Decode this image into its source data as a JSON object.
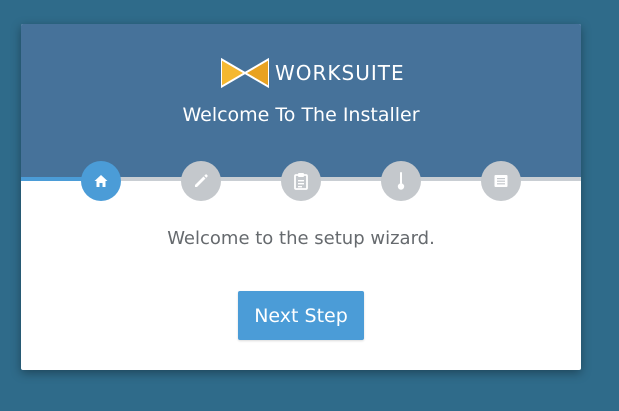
{
  "brand": {
    "name": "WORKSUITE",
    "icon": "bowtie-logo-icon",
    "colors": {
      "left": "#f5b830",
      "right": "#e8a221"
    }
  },
  "header": {
    "title": "Welcome To The Installer",
    "background": "#46729a"
  },
  "steps": [
    {
      "icon": "home-icon",
      "active": true
    },
    {
      "icon": "pencil-icon",
      "active": false
    },
    {
      "icon": "clipboard-icon",
      "active": false
    },
    {
      "icon": "thermometer-icon",
      "active": false
    },
    {
      "icon": "list-icon",
      "active": false
    }
  ],
  "progress": {
    "current_step": 1,
    "total_steps": 5
  },
  "body": {
    "message": "Welcome to the setup wizard."
  },
  "actions": {
    "next_label": "Next Step"
  },
  "colors": {
    "accent": "#4b9cd7",
    "inactive_step": "#c4c8cc",
    "page_background": "#2f6b8a"
  }
}
